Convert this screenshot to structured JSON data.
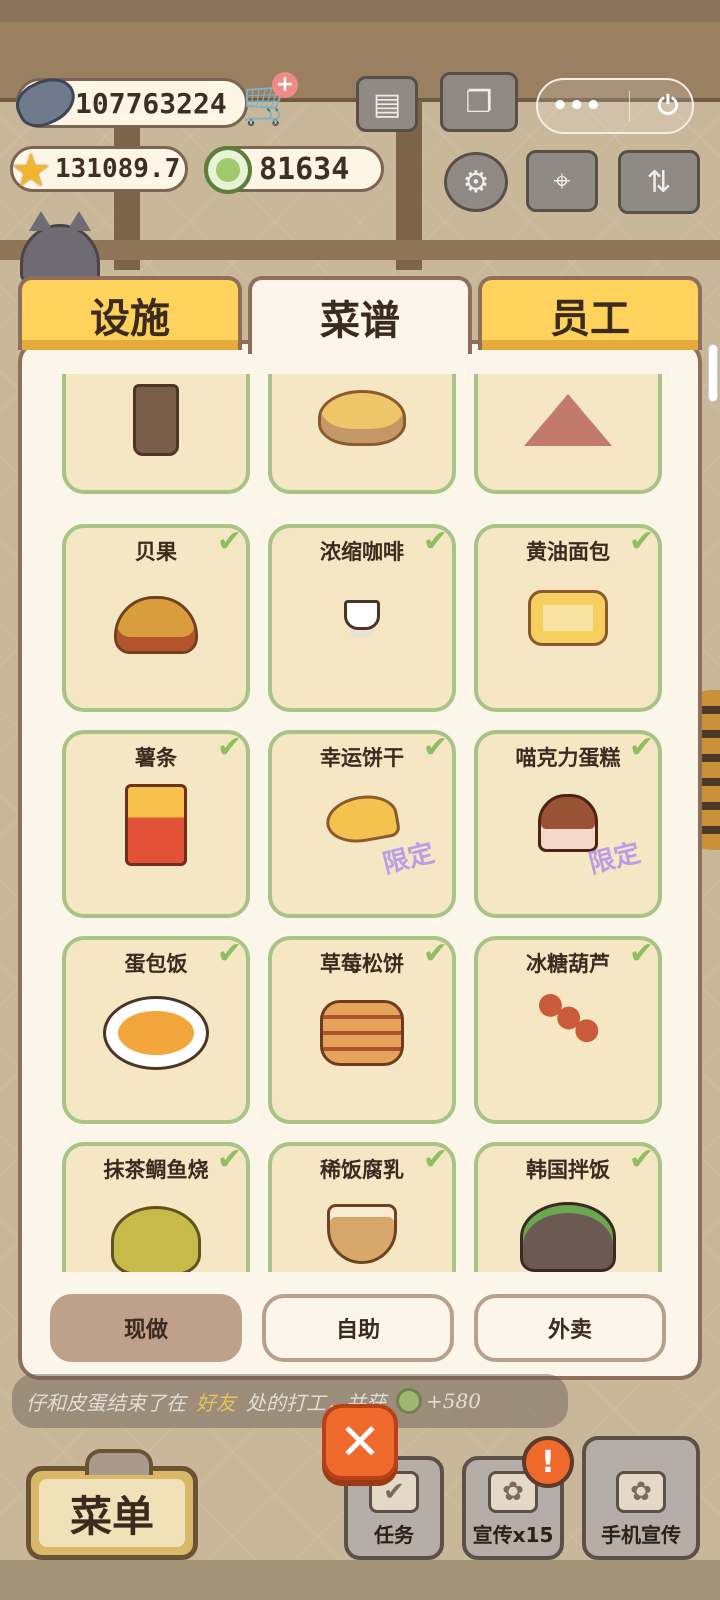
{
  "hud": {
    "fish": "107763224",
    "star": "131089.7",
    "coin": "81634"
  },
  "tabs": [
    {
      "label": "设施",
      "active": false
    },
    {
      "label": "菜谱",
      "active": true
    },
    {
      "label": "员工",
      "active": false
    }
  ],
  "recipes": [
    {
      "name": "",
      "checked": false,
      "limited": false,
      "food": "chocolate-drink"
    },
    {
      "name": "",
      "checked": false,
      "limited": false,
      "food": "salad-bowl"
    },
    {
      "name": "",
      "checked": false,
      "limited": false,
      "food": "zongzi"
    },
    {
      "name": "贝果",
      "checked": true,
      "limited": false,
      "food": "bagel"
    },
    {
      "name": "浓缩咖啡",
      "checked": true,
      "limited": false,
      "food": "espresso"
    },
    {
      "name": "黄油面包",
      "checked": true,
      "limited": false,
      "food": "butter-toast"
    },
    {
      "name": "薯条",
      "checked": true,
      "limited": false,
      "food": "fries"
    },
    {
      "name": "幸运饼干",
      "checked": true,
      "limited": true,
      "food": "fortune-cookie"
    },
    {
      "name": "喵克力蛋糕",
      "checked": true,
      "limited": true,
      "food": "cat-cupcake"
    },
    {
      "name": "蛋包饭",
      "checked": true,
      "limited": false,
      "food": "omurice"
    },
    {
      "name": "草莓松饼",
      "checked": true,
      "limited": false,
      "food": "pancake"
    },
    {
      "name": "冰糖葫芦",
      "checked": true,
      "limited": false,
      "food": "tanghulu"
    },
    {
      "name": "抹茶鲷鱼烧",
      "checked": true,
      "limited": false,
      "food": "taiyaki"
    },
    {
      "name": "稀饭腐乳",
      "checked": true,
      "limited": false,
      "food": "porridge"
    },
    {
      "name": "韩国拌饭",
      "checked": true,
      "limited": false,
      "food": "bibimbap"
    }
  ],
  "limited_label": "限定",
  "modes": [
    {
      "label": "现做",
      "selected": true
    },
    {
      "label": "自助",
      "selected": false
    },
    {
      "label": "外卖",
      "selected": false
    }
  ],
  "ticker": {
    "part1": "仔和皮蛋结束了在",
    "friend": "好友",
    "part2": "处的打工，并获",
    "reward": "+580"
  },
  "bottom": {
    "menu": "菜单",
    "task": "任务",
    "promo": "宣传x15",
    "phone_promo": "手机宣传"
  },
  "colors": {
    "tab_inactive": "#ffd25c",
    "card_border": "#a7c486",
    "check": "#8fbd61",
    "limited": "#b99ee6",
    "close": "#f06a2d"
  }
}
